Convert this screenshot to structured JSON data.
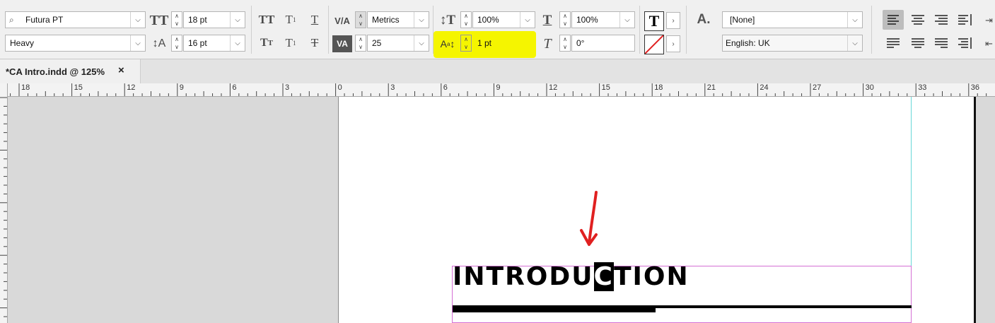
{
  "control_bar": {
    "font_family": "Futura PT",
    "font_style": "Heavy",
    "font_size": "18 pt",
    "leading": "16 pt",
    "kerning": "Metrics",
    "tracking": "25",
    "vertical_scale": "100%",
    "horizontal_scale": "100%",
    "baseline_shift": "1 pt",
    "skew": "0°",
    "character_style": "[None]",
    "language": "English: UK",
    "highlight_color": "#f5f500"
  },
  "tab": {
    "title": "*CA Intro.indd @ 125%",
    "close_glyph": "×"
  },
  "ruler": {
    "labels": [
      "18",
      "15",
      "12",
      "9",
      "6",
      "3",
      "0",
      "3",
      "6",
      "9",
      "12",
      "15",
      "18",
      "21",
      "24",
      "27",
      "30",
      "33",
      "36"
    ]
  },
  "document": {
    "heading_before": "INTRODU",
    "heading_selected": "C",
    "heading_after": "TION",
    "annotation_color": "#e02020"
  }
}
